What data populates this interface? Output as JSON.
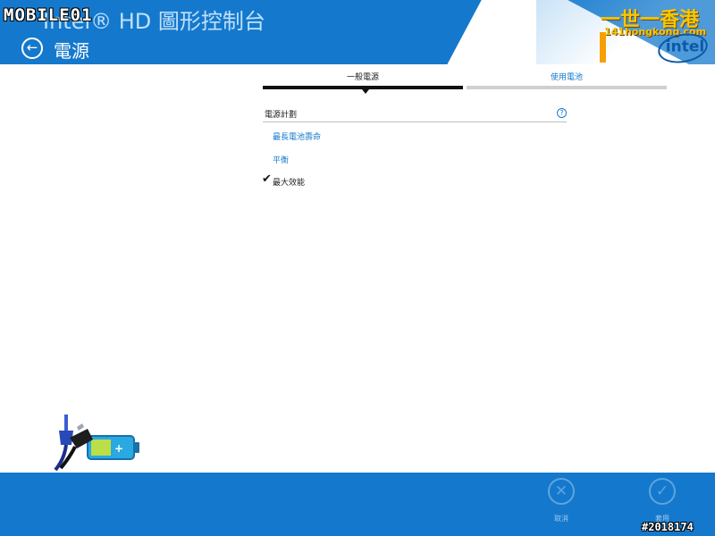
{
  "header": {
    "app_title": "Intel® HD 圖形控制台",
    "page_title": "電源",
    "back_icon": "arrow-left-icon",
    "brand_color": "#1479cc",
    "logo_text": "intel"
  },
  "watermarks": {
    "left": "MOBILE01",
    "right": "一世一香港",
    "url": "141hongkong.com",
    "post_id": "#2018174"
  },
  "tabs": [
    {
      "label": "一般電源",
      "selected": true
    },
    {
      "label": "使用電池",
      "selected": false
    }
  ],
  "power_plan": {
    "label": "電源計劃",
    "help_icon": "question-circle-icon",
    "options": [
      {
        "label": "最長電池壽命",
        "selected": false
      },
      {
        "label": "平衡",
        "selected": false
      },
      {
        "label": "最大效能",
        "selected": true
      }
    ],
    "check_icon": "checkmark-icon"
  },
  "illustration": "battery-plug-icon",
  "footer": {
    "cancel_label": "取消",
    "cancel_icon": "close-circle-icon",
    "apply_label": "套用",
    "apply_icon": "check-circle-icon"
  }
}
